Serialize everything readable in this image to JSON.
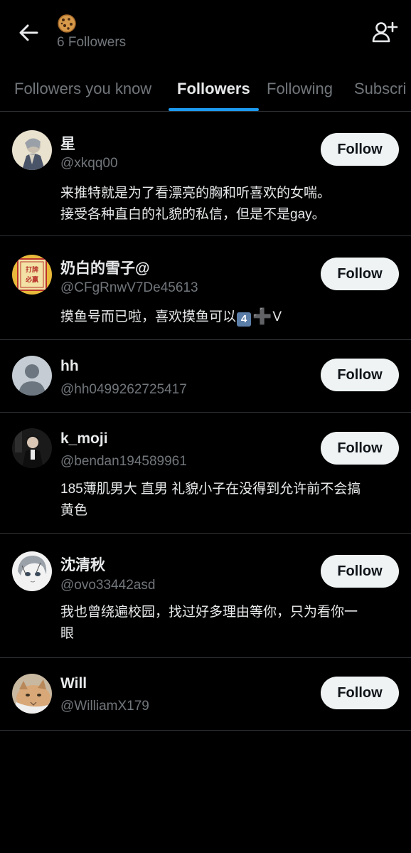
{
  "header": {
    "account_emoji": "🍪",
    "follower_count_text": "6 Followers",
    "back_icon": "back-arrow-icon",
    "add_user_icon": "add-user-icon"
  },
  "tabs": [
    {
      "label": "Followers you know"
    },
    {
      "label": "Followers",
      "active": true
    },
    {
      "label": "Following"
    },
    {
      "label": "Subscri"
    }
  ],
  "users": [
    {
      "name": "星",
      "handle": "@xkqq00",
      "bio_lines": [
        "来推特就是为了看漂亮的胸和听喜欢的女喘。",
        "接受各种直白的礼貌的私信，但是不是gay。"
      ],
      "button": "Follow"
    },
    {
      "name": "奶白的雪子@",
      "handle": "@CFgRnwV7De45613",
      "bio_prefix": "摸鱼号而已啦，喜欢摸鱼可以",
      "bio_key": "4",
      "bio_plus": "➕",
      "bio_suffix": "V",
      "avatar_text": "打牌必赢",
      "button": "Follow"
    },
    {
      "name": "hh",
      "handle": "@hh0499262725417",
      "button": "Follow"
    },
    {
      "name": "k_moji",
      "handle": "@bendan194589961",
      "bio_lines": [
        "185薄肌男大 直男 礼貌小子在没得到允许前不会搞",
        "黄色"
      ],
      "button": "Follow"
    },
    {
      "name": "沈清秋",
      "handle": "@ovo33442asd",
      "bio_lines": [
        "我也曾绕遍校园，找过好多理由等你，只为看你一",
        "眼"
      ],
      "button": "Follow"
    },
    {
      "name": "Will",
      "handle": "@WilliamX179",
      "button": "Follow"
    }
  ]
}
